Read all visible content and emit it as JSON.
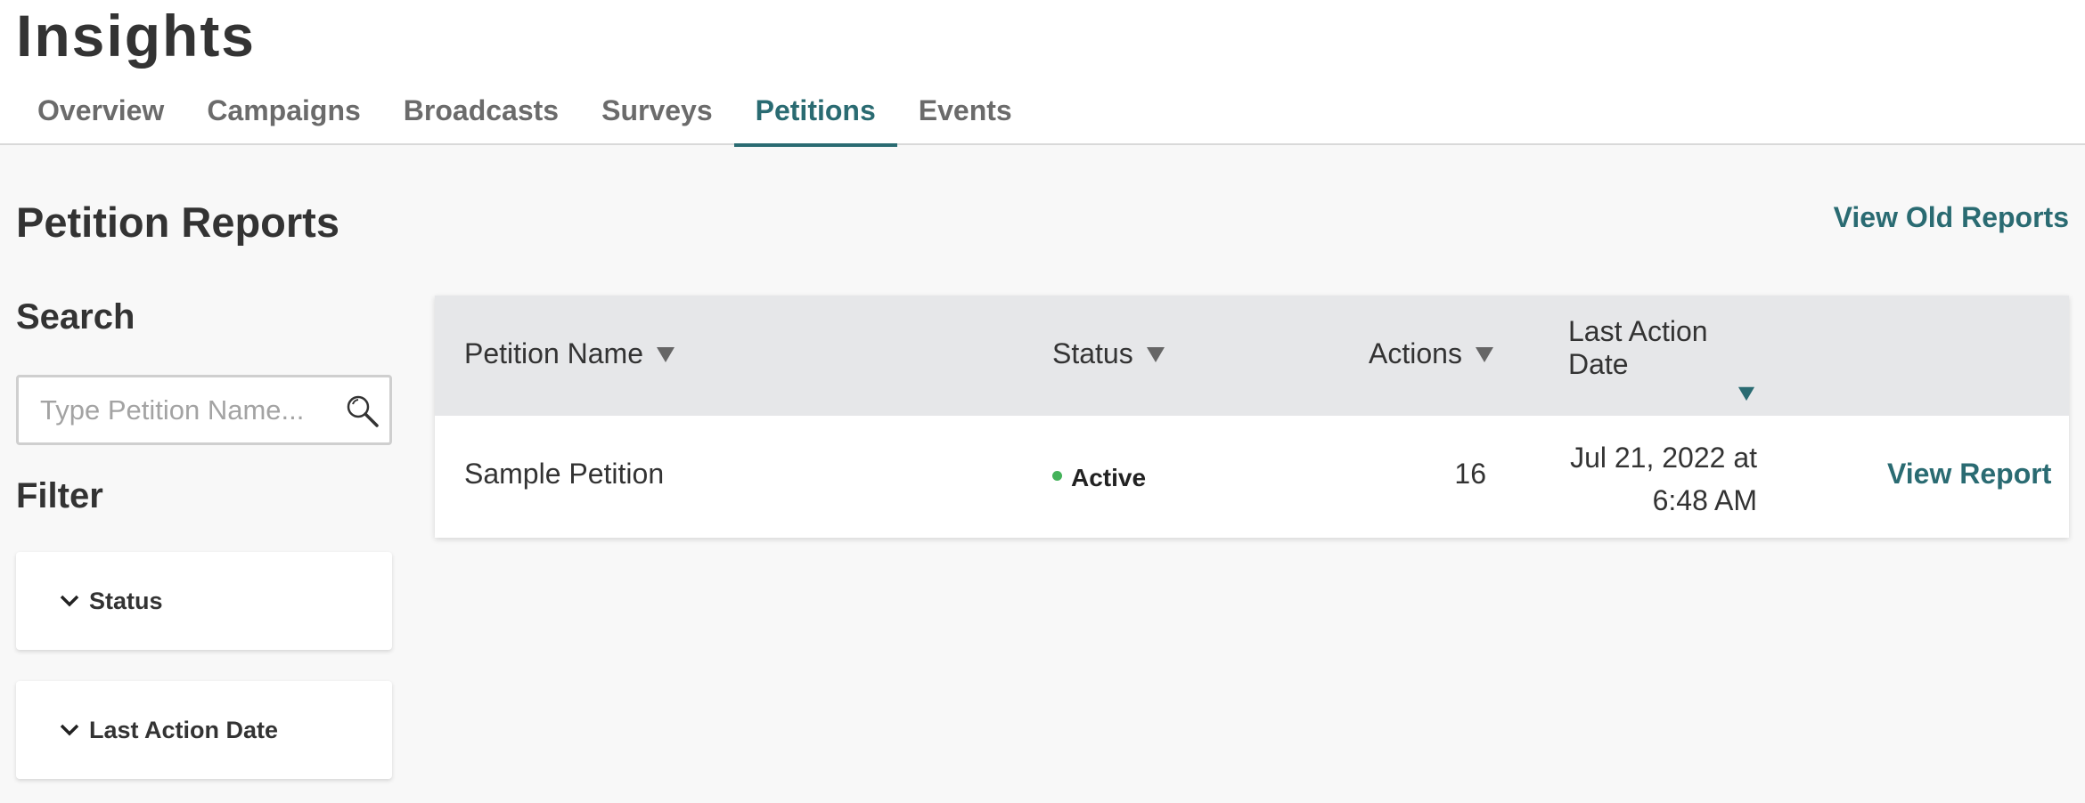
{
  "app": {
    "title": "Insights"
  },
  "tabs": [
    {
      "label": "Overview"
    },
    {
      "label": "Campaigns"
    },
    {
      "label": "Broadcasts"
    },
    {
      "label": "Surveys"
    },
    {
      "label": "Petitions",
      "active": true
    },
    {
      "label": "Events"
    }
  ],
  "page": {
    "title": "Petition Reports",
    "view_old_reports": "View Old Reports"
  },
  "sidebar": {
    "search_heading": "Search",
    "search_placeholder": "Type Petition Name...",
    "search_value": "",
    "filter_heading": "Filter",
    "filters": [
      {
        "label": "Status"
      },
      {
        "label": "Last Action Date"
      }
    ]
  },
  "table": {
    "columns": {
      "name": "Petition Name",
      "status": "Status",
      "actions": "Actions",
      "last_action_line1": "Last Action Date"
    },
    "rows": [
      {
        "name": "Sample Petition",
        "status": "Active",
        "actions": "16",
        "date_line1": "Jul 21, 2022 at",
        "date_line2": "6:48 AM",
        "link": "View Report"
      }
    ]
  },
  "colors": {
    "accent": "#2a6b72",
    "active_status": "#44b25a",
    "header_bg": "#e6e7e9",
    "page_bg": "#f8f8f8"
  },
  "icons": {
    "search": "search-icon",
    "chevron": "chevron-down-icon",
    "sort": "sort-triangle-icon"
  }
}
